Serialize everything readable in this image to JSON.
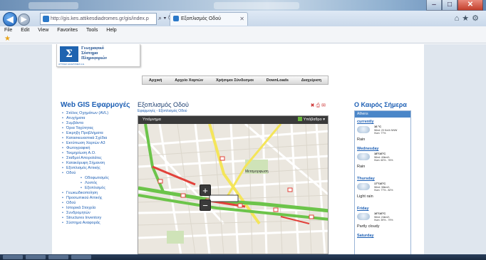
{
  "browser": {
    "address": "http://gis.kes.attikesdiadromes.gr/gis/index.p",
    "address_domain": "attikesdiadromes.gr",
    "tab_title": "Εξοπλισμός Οδού",
    "menu": [
      "File",
      "Edit",
      "View",
      "Favorites",
      "Tools",
      "Help"
    ],
    "window_buttons": {
      "minimize": "–",
      "maximize": "□",
      "close": "✕"
    }
  },
  "header": {
    "logo_lines": [
      "Γεωγραφικό",
      "Σύστημα",
      "Πληροφοριών"
    ],
    "logo_caption": "ΑΤΤΙΚΕΣ ΔΙΑΔΡΟΜΕΣ Α.Ε.",
    "nav": [
      "Αρχική",
      "Αρχείο Χαρτών",
      "Χρήσιμοι Σύνδεσμοι",
      "DownLoads",
      "Διαχείριση"
    ]
  },
  "sidebar": {
    "title": "Web GIS Εφαρμογές",
    "items": [
      {
        "label": "Στόλος Οχημάτων (AVL)",
        "sub": false
      },
      {
        "label": "Ατυχήματα",
        "sub": false
      },
      {
        "label": "Συμβάντα",
        "sub": false
      },
      {
        "label": "Όρια Ταχύτητας",
        "sub": false
      },
      {
        "label": "Εικρηξη Προβλήματα",
        "sub": false
      },
      {
        "label": "Κατασκευαστικά Σχέδια",
        "sub": false
      },
      {
        "label": "Εκτύπωση Χαρτών Α3",
        "sub": false
      },
      {
        "label": "Φωτογραφική",
        "sub": false
      },
      {
        "label": "Τεκμηρίωση Α.Ο.",
        "sub": false
      },
      {
        "label": "Σταθμοί Απορολάτες",
        "sub": false
      },
      {
        "label": "Κατακόρυφη Σήμανση",
        "sub": false
      },
      {
        "label": "Εξοπλισμός Αττικής",
        "sub": false
      },
      {
        "label": "Οδού",
        "sub": false
      },
      {
        "label": "Οδοφωτισμός",
        "sub": true
      },
      {
        "label": "Λοιπός",
        "sub": true
      },
      {
        "label": "Εξοπλισμός",
        "sub": true
      },
      {
        "label": "Γεωκωδικοποίηση",
        "sub": false
      },
      {
        "label": "Προσωπικού Αττικής",
        "sub": false
      },
      {
        "label": "Οδού",
        "sub": false
      },
      {
        "label": "Ιστορικά Στοιχεία",
        "sub": false
      },
      {
        "label": "Συνδρομητών",
        "sub": false
      },
      {
        "label": "Structures Inventory",
        "sub": false
      },
      {
        "label": "Σύστημα Αναφοράς",
        "sub": false
      }
    ]
  },
  "center": {
    "title": "Εξοπλισμός Οδού",
    "breadcrumb": "Εφαρμογές - Εξοπλισμός Οδού",
    "map_bar_left": "Υπόμνημα",
    "map_bar_right": "Υπόβαθρο ▾",
    "map_label": "Μεταμορφωση",
    "zoom_in": "+",
    "zoom_out": "−"
  },
  "weather": {
    "title": "Ο Καιρός Σήμερα",
    "city": "Athens",
    "days": [
      {
        "day": "currently",
        "temp": "16 °C",
        "wind": "Wind: 20 Km/h NNW",
        "hum": "Hum: 77%",
        "cond": "Rain"
      },
      {
        "day": "Wednesday",
        "temp": "18°/16°C",
        "wind": "Wind: 40km/h",
        "hum": "Hum: 60% - 76%",
        "cond": "Rain"
      },
      {
        "day": "Thursday",
        "temp": "17°/16°C",
        "wind": "Wind: 38km/h",
        "hum": "Hum: 77% - 82%",
        "cond": "Light rain"
      },
      {
        "day": "Friday",
        "temp": "16°/16°C",
        "wind": "Wind: 24km/h",
        "hum": "Hum: 39% - 79%",
        "cond": "Partly cloudy"
      },
      {
        "day": "Saturday",
        "temp": "",
        "wind": "",
        "hum": "",
        "cond": ""
      }
    ]
  }
}
